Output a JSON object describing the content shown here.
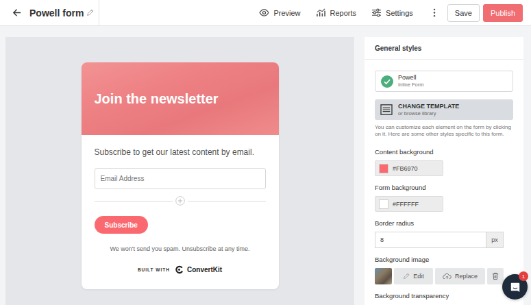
{
  "topbar": {
    "title": "Powell form",
    "actions": [
      {
        "label": "Preview"
      },
      {
        "label": "Reports"
      },
      {
        "label": "Settings"
      }
    ],
    "buttons": [
      {
        "label": "Save"
      },
      {
        "label": "Publish"
      }
    ]
  },
  "form": {
    "heading": "Join the newsletter",
    "subtitle": "Subscribe to get our latest content by email.",
    "email_placeholder": "Email Address",
    "button": "Subscribe",
    "disclaimer": "We won't send you spam. Unsubscribe at any time.",
    "built_with": "BUILT WITH",
    "brand": "ConvertKit"
  },
  "panel": {
    "title": "General styles",
    "template": {
      "name": "Powell",
      "type": "Inline Form"
    },
    "change_template": {
      "label": "CHANGE TEMPLATE",
      "sub": "or browse library"
    },
    "help": "You can customize each element on the form by clicking on it. Here are some other styles specific to this form.",
    "fields": [
      {
        "kind": "color",
        "label": "Content background",
        "value": "#FB6970"
      },
      {
        "kind": "color",
        "label": "Form background",
        "value": "#FFFFFF"
      },
      {
        "kind": "number",
        "label": "Border radius",
        "value": "8",
        "unit": "px"
      },
      {
        "kind": "image",
        "label": "Background image",
        "buttons": [
          "Edit",
          "Replace"
        ]
      },
      {
        "kind": "heading",
        "label": "Background transparency"
      }
    ]
  },
  "chat": {
    "badge": "1"
  }
}
